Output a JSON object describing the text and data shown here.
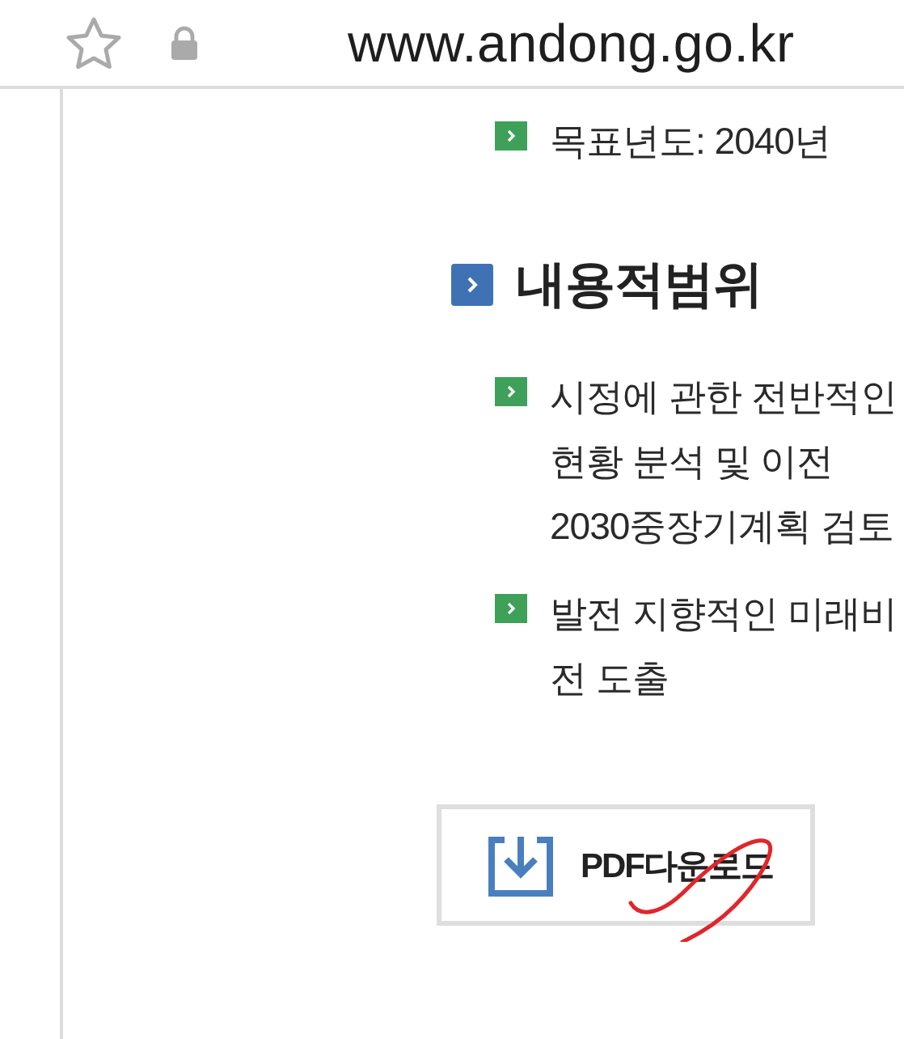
{
  "address_bar": {
    "url": "www.andong.go.kr"
  },
  "top_items": [
    {
      "text": "목표년도: 2040년"
    }
  ],
  "section": {
    "heading": "내용적범위",
    "items": [
      {
        "lines": [
          "시정에 관한 전반적인",
          "현황 분석 및 이전",
          "2030중장기계획 검토"
        ]
      },
      {
        "lines": [
          "발전 지향적인 미래비",
          "전 도출"
        ]
      }
    ]
  },
  "download_button": {
    "label": "PDF다운로드"
  }
}
